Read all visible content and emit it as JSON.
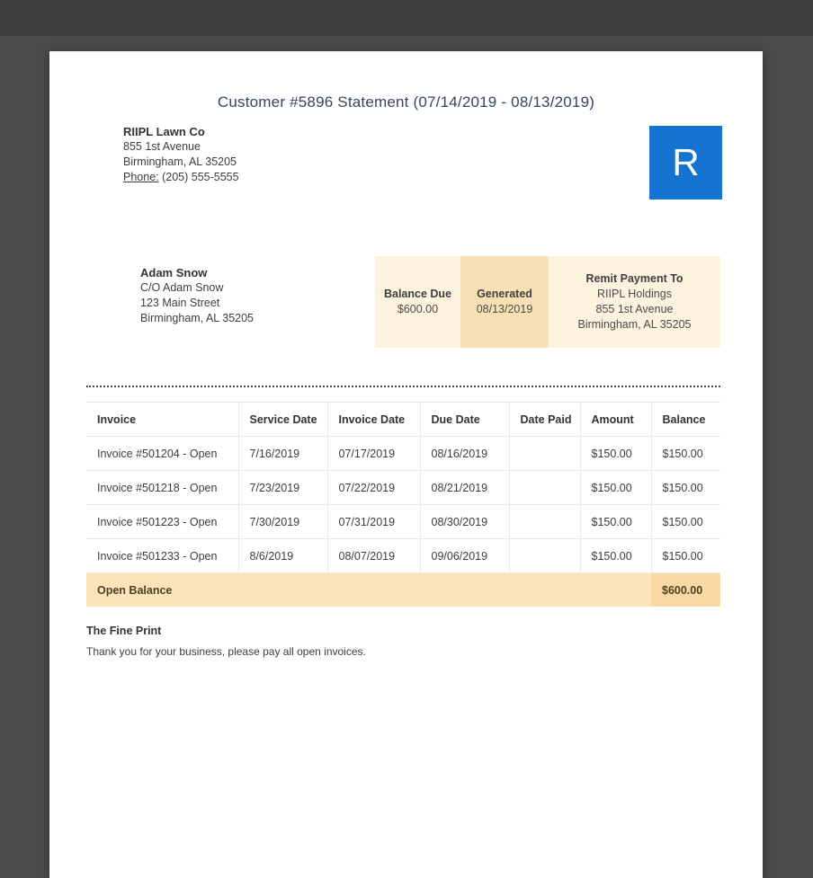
{
  "header": {
    "title": "Customer #5896 Statement (07/14/2019 - 08/13/2019)"
  },
  "company": {
    "name": "RIIPL Lawn Co",
    "address_line1": "855 1st Avenue",
    "address_line2": "Birmingham, AL 35205",
    "phone_label": "Phone:",
    "phone_number": "(205) 555-5555",
    "logo_letter": "R"
  },
  "customer": {
    "name": "Adam Snow",
    "line1": "C/O Adam Snow",
    "line2": "123 Main Street",
    "line3": "Birmingham, AL 35205"
  },
  "summary": {
    "balance_due": {
      "label": "Balance Due",
      "value": "$600.00"
    },
    "generated": {
      "label": "Generated",
      "value": "08/13/2019"
    },
    "remit": {
      "label": "Remit Payment To",
      "line1": "RIIPL Holdings",
      "line2": "855 1st Avenue",
      "line3": "Birmingham, AL 35205"
    }
  },
  "table": {
    "headers": [
      "Invoice",
      "Service Date",
      "Invoice Date",
      "Due Date",
      "Date Paid",
      "Amount",
      "Balance"
    ],
    "rows": [
      {
        "invoice": "Invoice #501204 - Open",
        "service_date": "7/16/2019",
        "invoice_date": "07/17/2019",
        "due_date": "08/16/2019",
        "date_paid": "",
        "amount": "$150.00",
        "balance": "$150.00"
      },
      {
        "invoice": "Invoice #501218 - Open",
        "service_date": "7/23/2019",
        "invoice_date": "07/22/2019",
        "due_date": "08/21/2019",
        "date_paid": "",
        "amount": "$150.00",
        "balance": "$150.00"
      },
      {
        "invoice": "Invoice #501223 - Open",
        "service_date": "7/30/2019",
        "invoice_date": "07/31/2019",
        "due_date": "08/30/2019",
        "date_paid": "",
        "amount": "$150.00",
        "balance": "$150.00"
      },
      {
        "invoice": "Invoice #501233 - Open",
        "service_date": "8/6/2019",
        "invoice_date": "08/07/2019",
        "due_date": "09/06/2019",
        "date_paid": "",
        "amount": "$150.00",
        "balance": "$150.00"
      }
    ],
    "footer": {
      "label": "Open Balance",
      "value": "$600.00"
    }
  },
  "fine_print": {
    "title": "The Fine Print",
    "body": "Thank you for your business, please pay all open invoices."
  },
  "colors": {
    "backdrop": "#4b4b4b",
    "page_bg": "#ffffff",
    "logo_blue": "#1674d1",
    "title_text": "#35455a",
    "summary_bg": "#fdf2dd",
    "summary_generated_bg": "#f8e0b4",
    "open_balance_bg": "#fbe4ba",
    "open_balance_value_bg": "#f7d9a1"
  }
}
